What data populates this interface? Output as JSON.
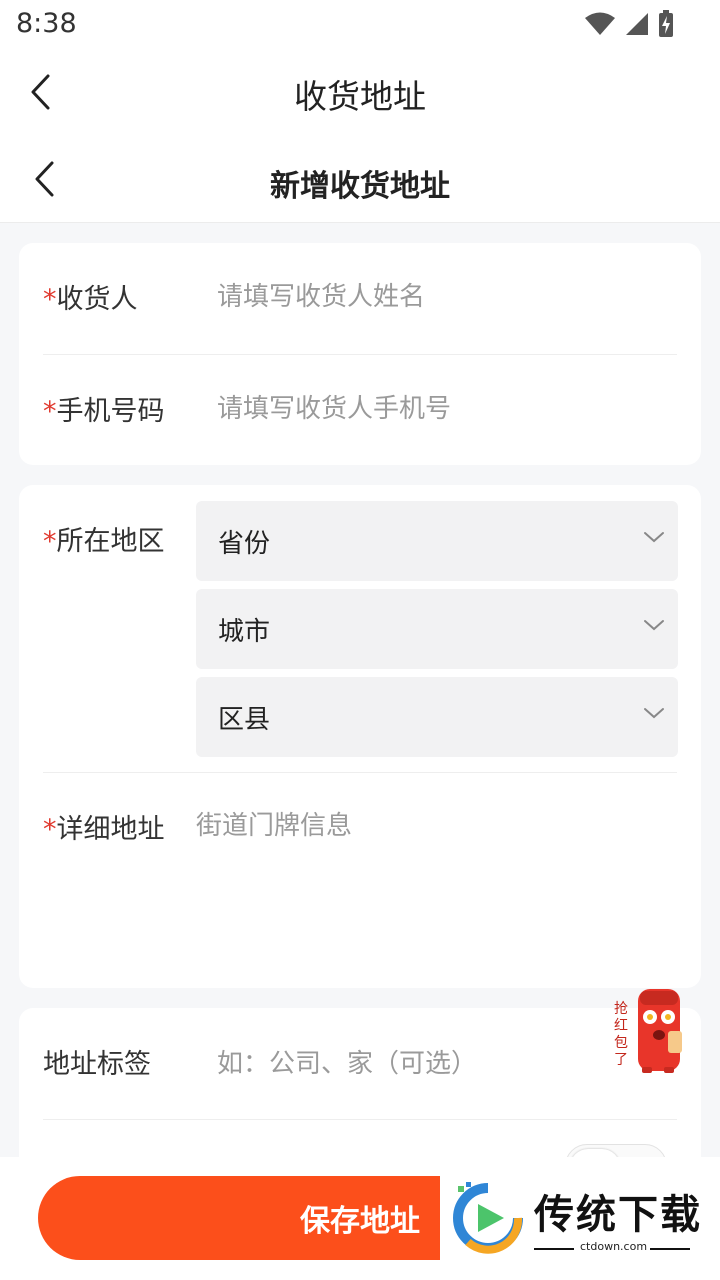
{
  "status_bar": {
    "time": "8:38"
  },
  "nav_primary": {
    "title": "收货地址"
  },
  "nav_secondary": {
    "title": "新增收货地址"
  },
  "form": {
    "required_mark": "*",
    "receiver": {
      "label": "收货人",
      "placeholder": "请填写收货人姓名",
      "value": ""
    },
    "phone": {
      "label": "手机号码",
      "placeholder": "请填写收货人手机号",
      "value": ""
    },
    "region": {
      "label": "所在地区",
      "province": "省份",
      "city": "城市",
      "district": "区县"
    },
    "detail": {
      "label": "详细地址",
      "placeholder": "街道门牌信息",
      "value": ""
    },
    "tag": {
      "label": "地址标签",
      "placeholder": "如：公司、家（可选）",
      "value": ""
    },
    "default_toggle": {
      "on": false
    }
  },
  "floating": {
    "red_packet_text": "抢红包了"
  },
  "footer": {
    "save_label": "保存地址"
  },
  "watermark": {
    "brand": "传统下载",
    "site": "ctdown.com"
  },
  "colors": {
    "accent": "#fc4f1b",
    "required": "#e03a2f",
    "page_bg": "#f6f7f9"
  }
}
